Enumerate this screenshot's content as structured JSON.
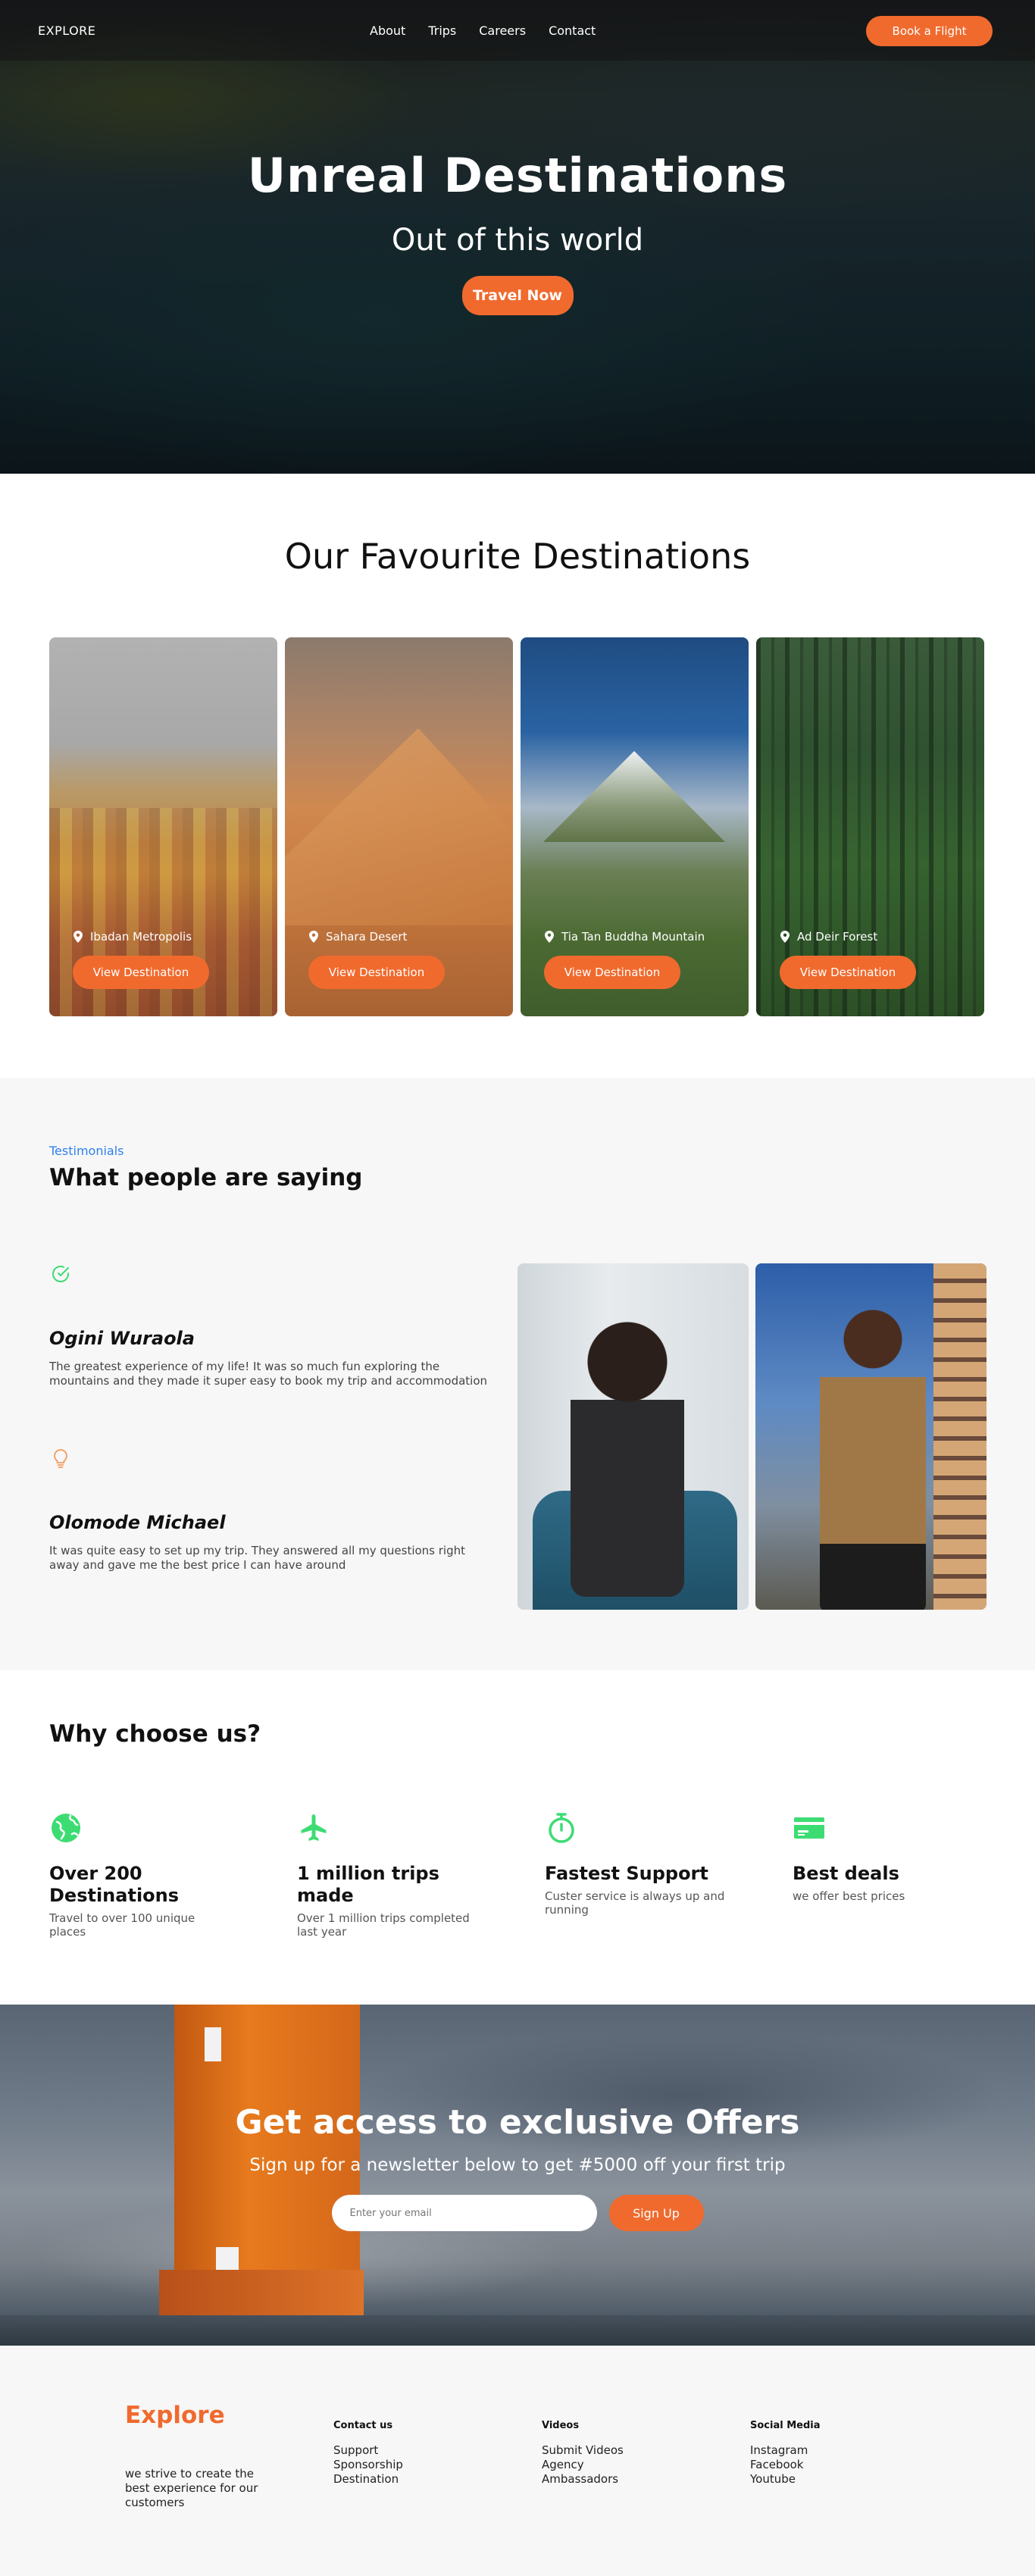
{
  "nav": {
    "logo": "EXPLORE",
    "links": [
      "About",
      "Trips",
      "Careers",
      "Contact"
    ],
    "cta": "Book a Flight"
  },
  "hero": {
    "title": "Unreal Destinations",
    "subtitle": "Out of this world",
    "cta": "Travel Now"
  },
  "destinations": {
    "title": "Our Favourite Destinations",
    "button_label": "View Destination",
    "items": [
      {
        "name": "Ibadan Metropolis"
      },
      {
        "name": "Sahara Desert"
      },
      {
        "name": "Tia Tan Buddha Mountain"
      },
      {
        "name": "Ad Deir Forest"
      }
    ]
  },
  "testimonials": {
    "tag": "Testimonials",
    "title": "What people are saying",
    "items": [
      {
        "name": "Ogini Wuraola",
        "text": "The greatest experience of my life! It was so much fun exploring the mountains and they made it super easy to book my trip and accommodation",
        "icon": "check-circle-icon"
      },
      {
        "name": "Olomode Michael",
        "text": "It was quite easy to set up my trip. They answered all my questions right away and gave me the best price I can have around",
        "icon": "lightbulb-icon"
      }
    ]
  },
  "why": {
    "title": "Why choose us?",
    "features": [
      {
        "title": "Over 200 Destinations",
        "text": "Travel to over 100 unique places",
        "icon": "globe-icon"
      },
      {
        "title": "1 million trips made",
        "text": "Over 1 million trips completed last year",
        "icon": "plane-icon"
      },
      {
        "title": "Fastest Support",
        "text": "Custer service is always up and running",
        "icon": "stopwatch-icon"
      },
      {
        "title": "Best deals",
        "text": "we offer best prices",
        "icon": "card-icon"
      }
    ]
  },
  "newsletter": {
    "title": "Get access to exclusive Offers",
    "subtitle": "Sign up for a newsletter below to get #5000 off your first trip",
    "placeholder": "Enter your email",
    "cta": "Sign Up"
  },
  "footer": {
    "logo": "Explore",
    "tagline": "we strive to create the best experience for our customers",
    "columns": [
      {
        "title": "Contact us",
        "links": [
          "Support",
          "Sponsorship",
          "Destination"
        ]
      },
      {
        "title": "Videos",
        "links": [
          "Submit Videos",
          "Agency",
          "Ambassadors"
        ]
      },
      {
        "title": "Social Media",
        "links": [
          "Instagram",
          "Facebook",
          "Youtube"
        ]
      }
    ]
  },
  "colors": {
    "accent": "#f06a2e",
    "link_blue": "#2f80ed",
    "icon_green": "#3ddc73"
  }
}
